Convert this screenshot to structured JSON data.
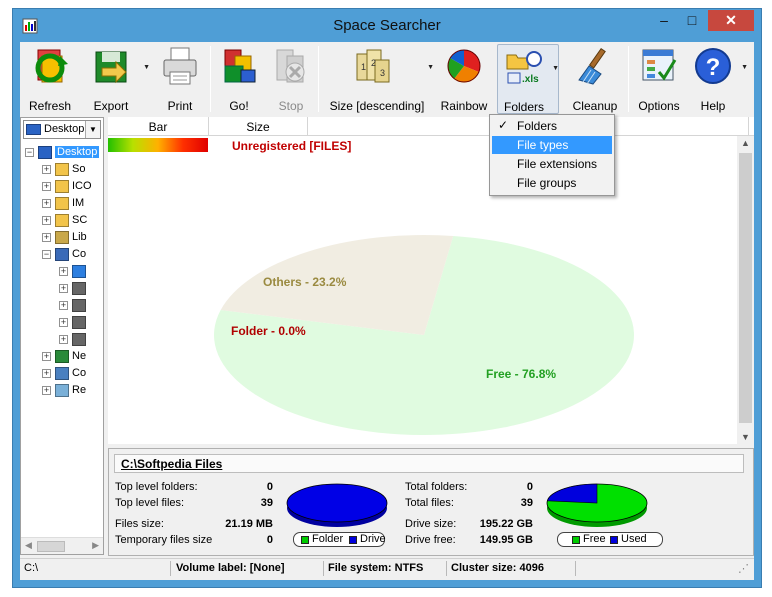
{
  "window": {
    "title": "Space Searcher",
    "minimize_glyph": "–",
    "maximize_glyph": "□",
    "close_glyph": "✕",
    "close_color": "#c7483e"
  },
  "toolbar": {
    "buttons": [
      {
        "label": "Refresh",
        "icon": "refresh-icon"
      },
      {
        "label": "Export",
        "icon": "export-icon",
        "has_dropdown": true
      },
      {
        "label": "Print",
        "icon": "printer-icon"
      },
      {
        "label": "Go!",
        "icon": "go-icon"
      },
      {
        "label": "Stop",
        "icon": "stop-icon",
        "disabled": true
      },
      {
        "label": "Size [descending]",
        "icon": "sort-icon",
        "has_dropdown": true
      },
      {
        "label": "Rainbow",
        "icon": "rainbow-icon",
        "has_dropdown": true
      },
      {
        "label": "Folders",
        "icon": "folders-icon",
        "has_dropdown": true,
        "pressed": true
      },
      {
        "label": "Cleanup",
        "icon": "broom-icon"
      },
      {
        "label": "Options",
        "icon": "options-icon"
      },
      {
        "label": "Help",
        "icon": "help-icon",
        "has_dropdown": true
      }
    ]
  },
  "drive_combo": {
    "value": "Desktop"
  },
  "tree": {
    "nodes": [
      {
        "label": "Desktop",
        "level": 0,
        "expanded": true,
        "selected": true,
        "icon": "desktop-icon"
      },
      {
        "label": "So",
        "level": 1,
        "icon": "folder-icon"
      },
      {
        "label": "ICO",
        "level": 1,
        "icon": "folder-icon"
      },
      {
        "label": "IM",
        "level": 1,
        "icon": "folder-icon"
      },
      {
        "label": "SC",
        "level": 1,
        "icon": "folder-icon"
      },
      {
        "label": "Lib",
        "level": 1,
        "icon": "libraries-icon"
      },
      {
        "label": "Co",
        "level": 1,
        "expanded": true,
        "icon": "computer-icon"
      },
      {
        "label": "",
        "level": 2,
        "icon": "windows-drive-icon"
      },
      {
        "label": "",
        "level": 2,
        "icon": "drive-icon"
      },
      {
        "label": "",
        "level": 2,
        "icon": "drive-icon"
      },
      {
        "label": "",
        "level": 2,
        "icon": "drive-icon"
      },
      {
        "label": "",
        "level": 2,
        "icon": "drive-icon"
      },
      {
        "label": "Ne",
        "level": 1,
        "icon": "network-icon"
      },
      {
        "label": "Co",
        "level": 1,
        "icon": "control-panel-icon"
      },
      {
        "label": "Re",
        "level": 1,
        "icon": "recycle-bin-icon"
      }
    ]
  },
  "columns": {
    "bar": "Bar",
    "size": "Size"
  },
  "chart_header": {
    "unregistered": "Unregistered [FILES]"
  },
  "chart_data": {
    "type": "pie",
    "series": [
      {
        "name": "Free",
        "label": "Free - 76.8%",
        "value": 76.8,
        "color": "#e0fbe0",
        "label_color": "#22a022"
      },
      {
        "name": "Others",
        "label": "Others - 23.2%",
        "value": 23.2,
        "color": "#f1ede2",
        "label_color": "#9a8a40"
      },
      {
        "name": "Folder",
        "label": "Folder - 0.0%",
        "value": 0.0,
        "color": "#ffffff",
        "label_color": "#b00000"
      }
    ]
  },
  "dropdown_menu": {
    "items": [
      {
        "label": "Folders",
        "checked": true,
        "highlighted": false
      },
      {
        "label": "File types",
        "checked": false,
        "highlighted": true
      },
      {
        "label": "File extensions",
        "checked": false,
        "highlighted": false
      },
      {
        "label": "File groups",
        "checked": false,
        "highlighted": false
      }
    ]
  },
  "info": {
    "path": "C:\\Softpedia Files",
    "top_level_folders_label": "Top level folders:",
    "top_level_folders": "0",
    "top_level_files_label": "Top level files:",
    "top_level_files": "39",
    "files_size_label": "Files size:",
    "files_size": "21.19 MB",
    "temp_files_size_label": "Temporary files size",
    "temp_files_size": "0",
    "total_folders_label": "Total folders:",
    "total_folders": "0",
    "total_files_label": "Total files:",
    "total_files": "39",
    "drive_size_label": "Drive size:",
    "drive_size": "195.22 GB",
    "drive_free_label": "Drive free:",
    "drive_free": "149.95 GB",
    "legend_folder": "Folder",
    "legend_drive": "Drive",
    "legend_free": "Free",
    "legend_used": "Used",
    "folder_share": 0.0,
    "free_share": 76.8
  },
  "statusbar": {
    "drive": "C:\\",
    "volume_label": "Volume label: [None]",
    "file_system": "File system: NTFS",
    "cluster_size": "Cluster size: 4096"
  }
}
